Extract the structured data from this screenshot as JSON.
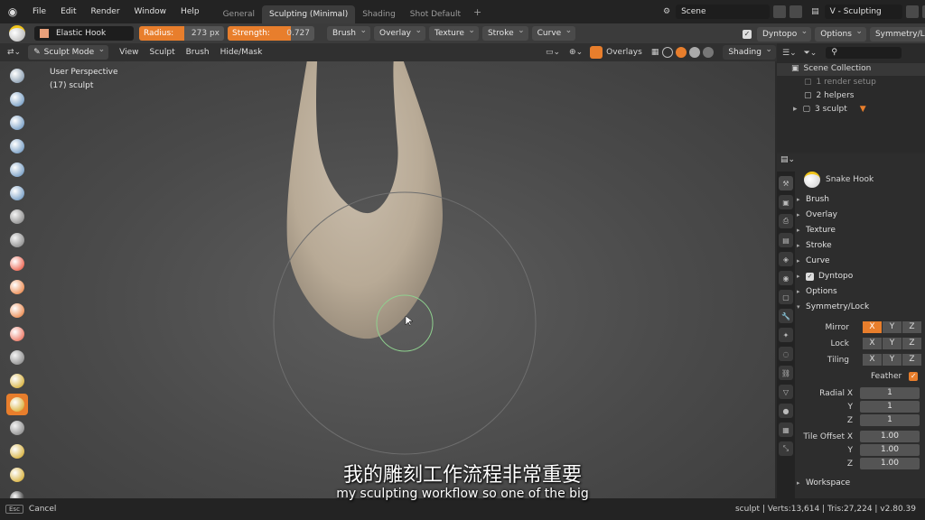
{
  "menu": {
    "items": [
      "File",
      "Edit",
      "Render",
      "Window",
      "Help"
    ],
    "tabs": [
      "General",
      "Sculpting (Minimal)",
      "Shading",
      "Shot Default"
    ],
    "active_tab": 1,
    "scene": "Scene",
    "view_layer": "V - Sculpting"
  },
  "tool": {
    "brush_name": "Elastic Hook",
    "radius_label": "Radius:",
    "radius_value": "273 px",
    "strength_label": "Strength:",
    "strength_value": "0.727",
    "strength_fraction": 0.727,
    "dropdowns": [
      "Brush",
      "Overlay",
      "Texture",
      "Stroke",
      "Curve"
    ],
    "dyntopo": "Dyntopo",
    "options": "Options",
    "symmetry": "Symmetry/Lock"
  },
  "header": {
    "mode": "Sculpt Mode",
    "menus": [
      "View",
      "Sculpt",
      "Brush",
      "Hide/Mask"
    ],
    "overlays": "Overlays",
    "shading": "Shading"
  },
  "viewport": {
    "perspective": "User Perspective",
    "object": "(17) sculpt"
  },
  "outliner": {
    "root": "Scene Collection",
    "items": [
      "1 render setup",
      "2 helpers",
      "3 sculpt"
    ]
  },
  "properties": {
    "brush": "Snake Hook",
    "panels": [
      "Brush",
      "Overlay",
      "Texture",
      "Stroke",
      "Curve",
      "Dyntopo",
      "Options",
      "Symmetry/Lock"
    ],
    "mirror": "Mirror",
    "lock": "Lock",
    "tiling": "Tiling",
    "axes": [
      "X",
      "Y",
      "Z"
    ],
    "feather": "Feather",
    "radial_x": "Radial X",
    "y": "Y",
    "z": "Z",
    "radial": [
      "1",
      "1",
      "1"
    ],
    "tile_offset": "Tile Offset X",
    "tile": [
      "1.00",
      "1.00",
      "1.00"
    ],
    "workspace": "Workspace"
  },
  "status": {
    "key": "Esc",
    "cancel": "Cancel",
    "stats": "sculpt | Verts:13,614 | Tris:27,224 | v2.80.39"
  },
  "subtitles": {
    "chinese": "我的雕刻工作流程非常重要",
    "english": "my sculpting workflow so one of the big"
  },
  "colors": {
    "accent": "#e87e2c",
    "sculpt": "#bcae9c"
  }
}
